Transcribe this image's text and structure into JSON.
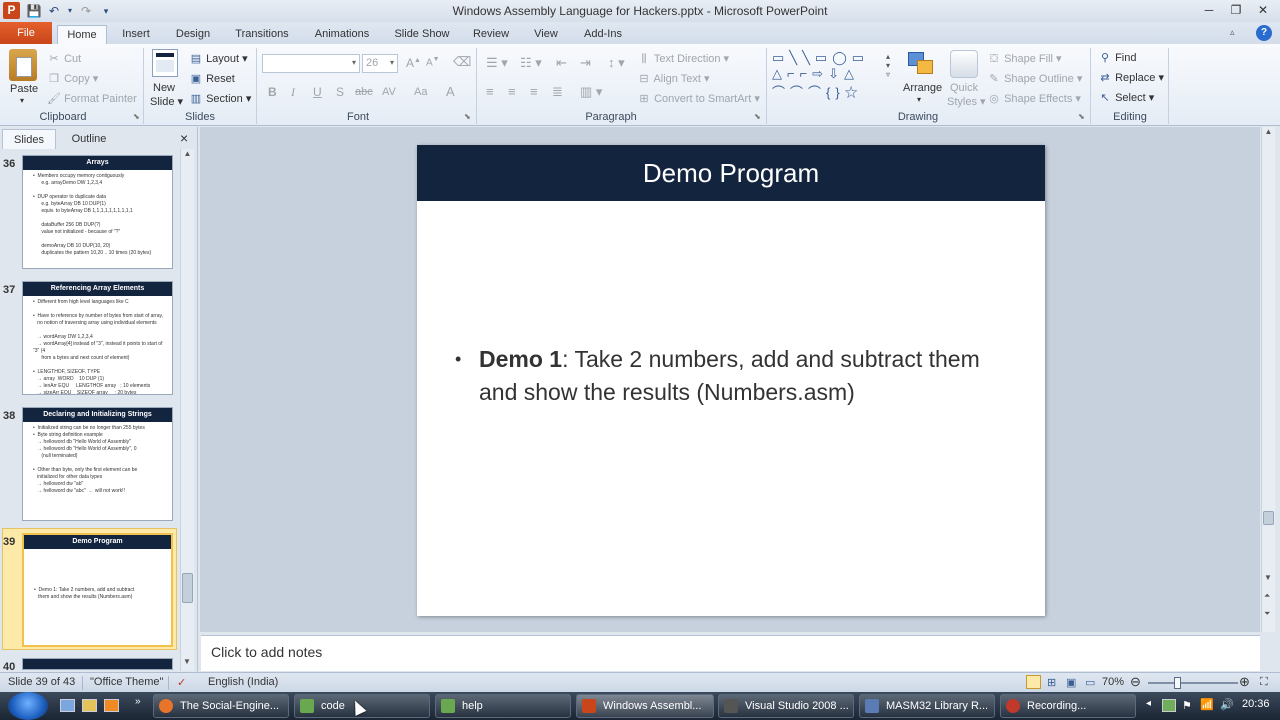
{
  "window": {
    "title": "Windows Assembly Language for Hackers.pptx  -  Microsoft PowerPoint",
    "app_icon": "P",
    "controls": [
      "─",
      "❐",
      "✕"
    ]
  },
  "ribbon_tabs": [
    "File",
    "Home",
    "Insert",
    "Design",
    "Transitions",
    "Animations",
    "Slide Show",
    "Review",
    "View",
    "Add-Ins"
  ],
  "clipboard": {
    "paste": "Paste",
    "cut": "Cut",
    "copy": "Copy",
    "format_painter": "Format Painter",
    "label": "Clipboard"
  },
  "slides_group": {
    "new_slide_1": "New",
    "new_slide_2": "Slide",
    "layout": "Layout",
    "reset": "Reset",
    "section": "Section",
    "label": "Slides"
  },
  "font_group": {
    "size": "26",
    "label": "Font",
    "bold": "B",
    "italic": "I",
    "underline": "U",
    "shadow": "S",
    "strike": "abc",
    "spacing": "AV",
    "case": "Aa",
    "color": "A"
  },
  "paragraph_group": {
    "text_direction": "Text Direction",
    "align_text": "Align Text",
    "convert_smartart": "Convert to SmartArt",
    "label": "Paragraph"
  },
  "drawing_group": {
    "arrange": "Arrange",
    "quick_styles_1": "Quick",
    "quick_styles_2": "Styles",
    "shape_fill": "Shape Fill",
    "shape_outline": "Shape Outline",
    "shape_effects": "Shape Effects",
    "label": "Drawing"
  },
  "editing_group": {
    "find": "Find",
    "replace": "Replace",
    "select": "Select",
    "label": "Editing"
  },
  "panel": {
    "tab_slides": "Slides",
    "tab_outline": "Outline",
    "close": "×"
  },
  "thumbnails": [
    {
      "num": "36",
      "title": "Arrays",
      "body": "•  Members occupy memory contiguously\n      e.g. arrayDemo DW 1,2,3,4\n\n•  DUP operator to duplicate data\n      e.g. byteArray DB 10 DUP(1)\n      equiv. to byteArray DB 1,1,1,1,1,1,1,1,1,1\n\n      dataBuffer 256 DB DUP(?)\n      value not initialized - because of \"?\"\n\n      demoArray DB 10 DUP(10, 20)\n      duplicates the pattern 10,20 .. 10 times (20 bytes)"
    },
    {
      "num": "37",
      "title": "Referencing Array Elements",
      "body": "•  Different from high level languages like C\n\n•  Have to reference by number of bytes from start of array,\n   no notion of traversing array using individual elements\n\n   → wordArray DW 1,2,3,4\n   → wordArray[4] instead of \"3\", instead it points to start of \"3\" (4\n      from a bytes and next count of element)\n\n•  LENGTHOF, SIZEOF, TYPE\n   → array  WORD    10 DUP (1)\n   → lenArr EQU     LENGTHOF array   ; 10 elements\n   → sizeArr EQU    SIZEOF array     ; 20 bytes\n   → typeArr EQU    TYPE array       ; 2 (bytes per element)"
    },
    {
      "num": "38",
      "title": "Declaring and Initializing Strings",
      "body": "•  Initialized string can be no longer than 255 bytes\n•  Byte string definition example\n   → helloword db \"Hello World of Assembly\"\n   → helloword db \"Hello World of Assembly\", 0\n      (null terminated)\n\n•  Other than byte, only the first element can be\n   initialized for other data types\n   → helloword dw \"ab\"\n   → helloword dw \"abc\"  ← will not work!!"
    },
    {
      "num": "39",
      "title": "Demo Program",
      "body": "\n\n\n\n\n•  Demo 1: Take 2 numbers, add and subtract\n   them and show the results (Numbers.asm)"
    },
    {
      "num": "40",
      "title": "",
      "body": ""
    }
  ],
  "slide": {
    "title": "Demo Program",
    "bullet_bold": "Demo 1",
    "bullet_text": ": Take 2 numbers, add and subtract them and show the results (Numbers.asm)"
  },
  "notes_placeholder": "Click to add notes",
  "status": {
    "slide_of": "Slide 39 of 43",
    "theme": "\"Office Theme\"",
    "language": "English (India)",
    "zoom": "70%"
  },
  "taskbar": {
    "items": [
      "The Social-Engine...",
      "code",
      "help",
      "Windows Assembl...",
      "Visual Studio 2008 ...",
      "MASM32 Library R...",
      "Recording..."
    ],
    "icon_colors": [
      "#e8742a",
      "#6aa84f",
      "#6aa84f",
      "#c9461b",
      "#555555",
      "#5b7bb5",
      "#c0392b"
    ],
    "clock": "20:36"
  }
}
